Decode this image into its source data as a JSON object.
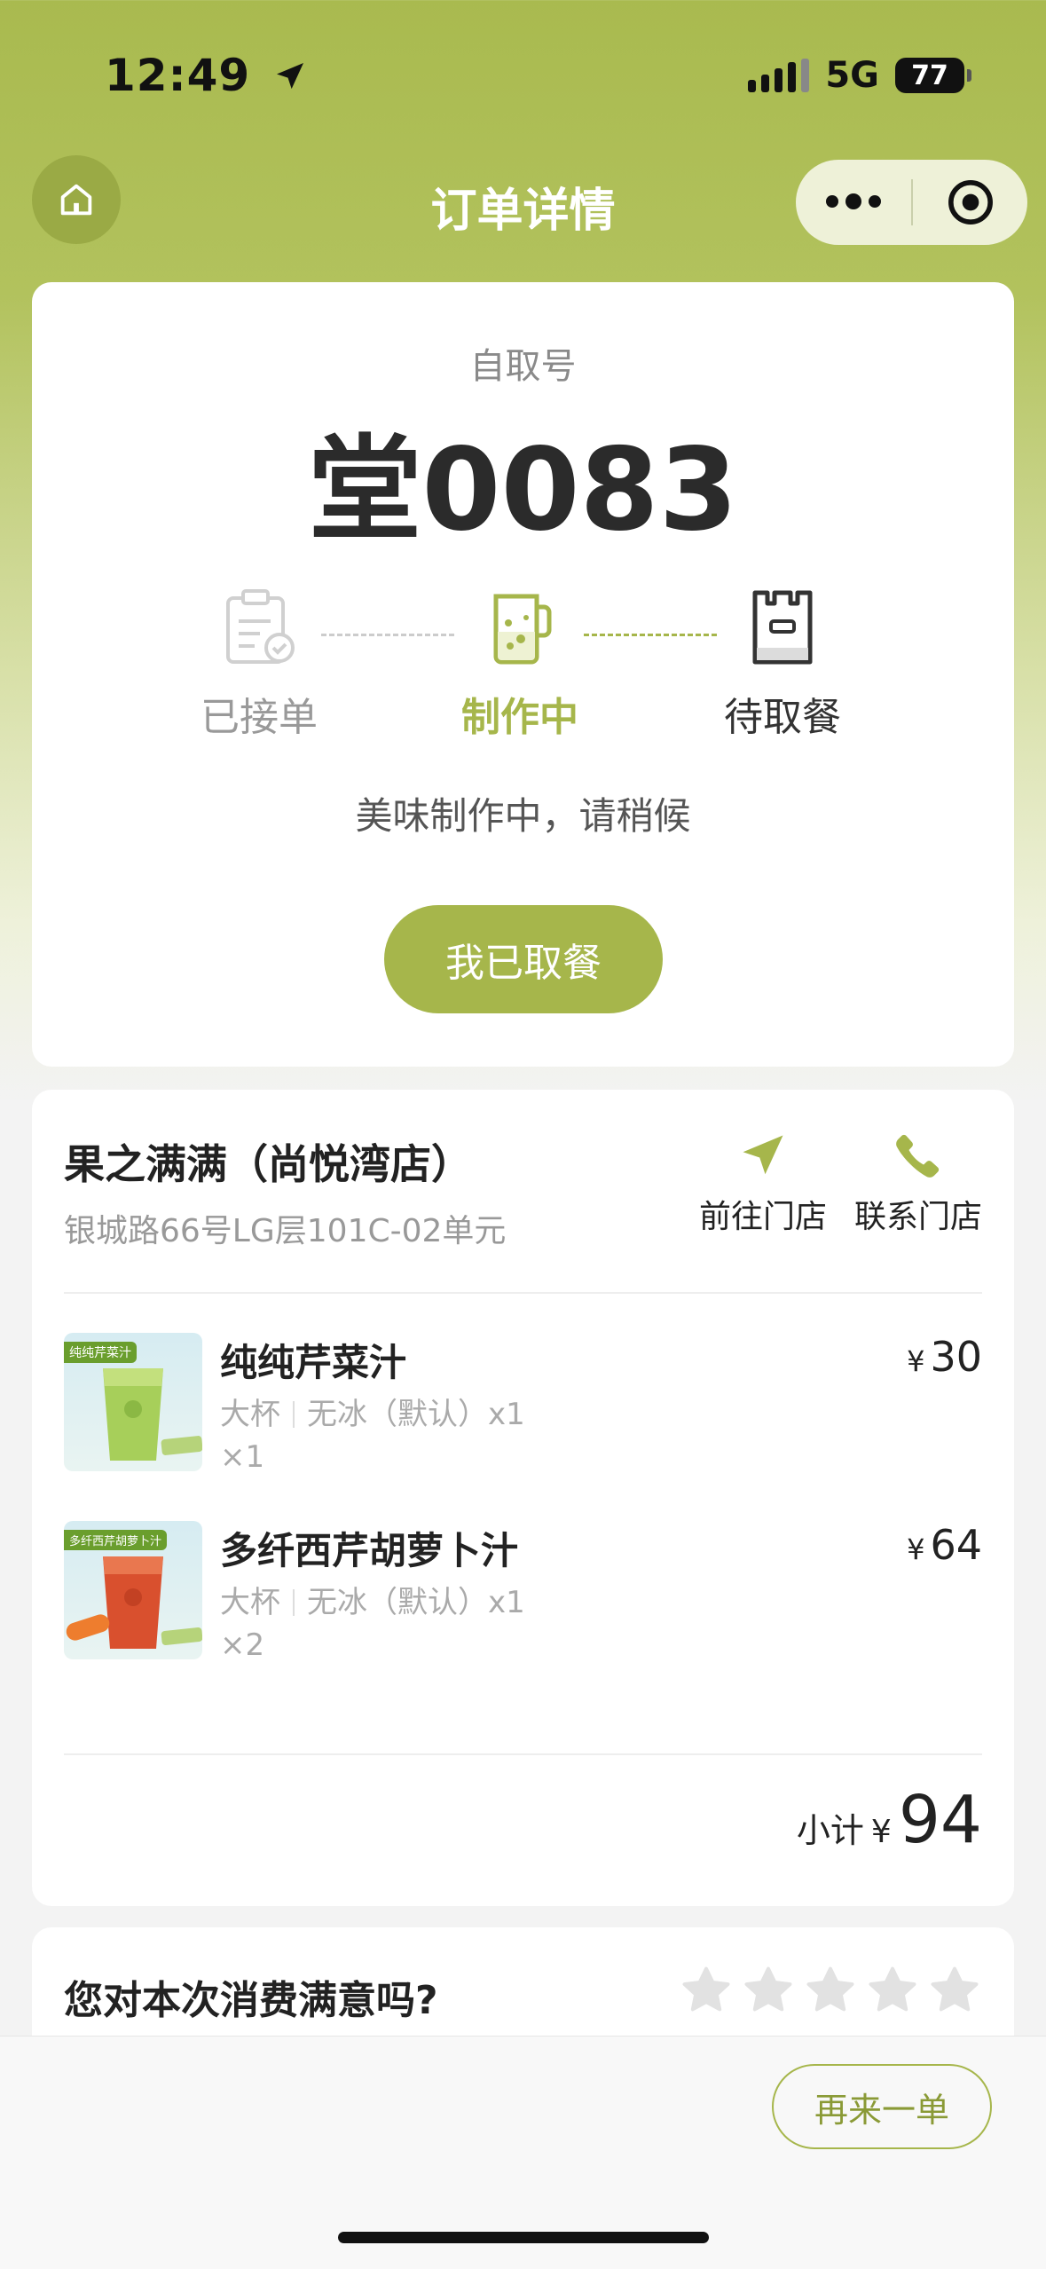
{
  "status_bar": {
    "time": "12:49",
    "network": "5G",
    "battery": "77"
  },
  "nav": {
    "title": "订单详情"
  },
  "order": {
    "pickup_label": "自取号",
    "pickup_code": "堂0083",
    "steps": [
      {
        "label": "已接单",
        "state": "done"
      },
      {
        "label": "制作中",
        "state": "active"
      },
      {
        "label": "待取餐",
        "state": "pending"
      }
    ],
    "status_message": "美味制作中，请稍候",
    "picked_button": "我已取餐"
  },
  "store": {
    "name": "果之满满（尚悦湾店）",
    "address": "银城路66号LG层101C-02单元",
    "navigate_label": "前往门店",
    "contact_label": "联系门店"
  },
  "items": [
    {
      "name": "纯纯芹菜汁",
      "size": "大杯",
      "spec": "无冰（默认）x1",
      "qty": "×1",
      "currency": "¥",
      "price": "30",
      "image_tag": "纯纯芹菜汁",
      "drink_color": "#a7cf5a"
    },
    {
      "name": "多纤西芹胡萝卜汁",
      "size": "大杯",
      "spec": "无冰（默认）x1",
      "qty": "×2",
      "currency": "¥",
      "price": "64",
      "image_tag": "多纤西芹胡萝卜汁",
      "drink_color": "#d9502e"
    }
  ],
  "subtotal": {
    "label": "小计",
    "currency": "¥",
    "amount": "94"
  },
  "rating": {
    "question": "您对本次消费满意吗?",
    "stars": 5
  },
  "footer": {
    "reorder_button": "再来一单"
  },
  "colors": {
    "accent": "#a6b64b",
    "header_bg": "#a9ba4f"
  },
  "icons": [
    "home-icon",
    "more-icon",
    "target-icon",
    "clipboard-check-icon",
    "juicer-icon",
    "bag-icon",
    "navigate-icon",
    "phone-icon",
    "star-icon"
  ]
}
